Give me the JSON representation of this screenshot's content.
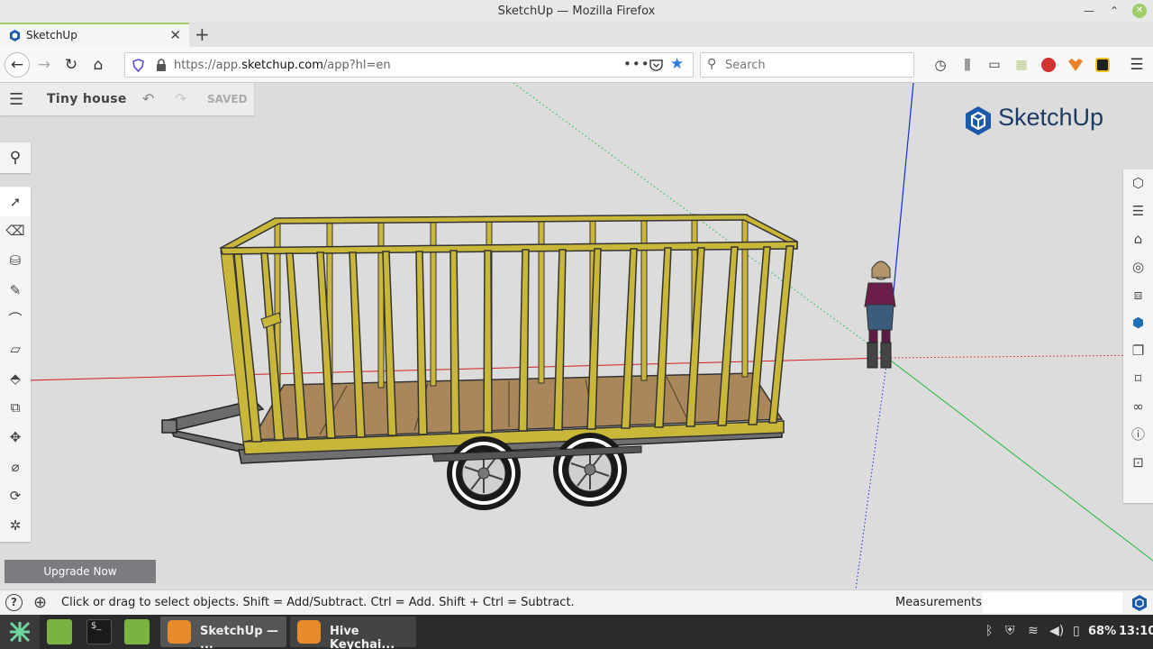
{
  "window": {
    "title": "SketchUp — Mozilla Firefox"
  },
  "browser": {
    "tab_label": "SketchUp",
    "url_prefix": "https://app.",
    "url_domain": "sketchup.com",
    "url_path": "/app?hl=en",
    "search_placeholder": "Search"
  },
  "app": {
    "doc_title": "Tiny house",
    "save_state": "SAVED",
    "upgrade_label": "Upgrade Now",
    "brand": "SketchUp"
  },
  "left_tools": [
    {
      "name": "select",
      "icon": "arrow-pointer-icon"
    },
    {
      "name": "eraser",
      "icon": "eraser-icon"
    },
    {
      "name": "paint",
      "icon": "paint-bucket-icon"
    },
    {
      "name": "line",
      "icon": "pencil-icon"
    },
    {
      "name": "arc",
      "icon": "arc-icon"
    },
    {
      "name": "rectangle",
      "icon": "rectangle-icon"
    },
    {
      "name": "push-pull",
      "icon": "push-pull-icon"
    },
    {
      "name": "offset",
      "icon": "offset-icon"
    },
    {
      "name": "move",
      "icon": "move-icon"
    },
    {
      "name": "tape",
      "icon": "tape-measure-icon"
    },
    {
      "name": "orbit",
      "icon": "orbit-icon"
    },
    {
      "name": "walk",
      "icon": "walk-icon"
    }
  ],
  "right_tools": [
    "entity-info-icon",
    "outliner-icon",
    "instructor-icon",
    "materials-icon",
    "components-icon",
    "styles-icon",
    "layers-icon",
    "scenes-icon",
    "display-icon",
    "model-info-icon",
    "extension-icon"
  ],
  "status": {
    "hint": "Click or drag to select objects. Shift = Add/Subtract. Ctrl = Add. Shift + Ctrl = Subtract.",
    "measurements_label": "Measurements",
    "measurements_value": ""
  },
  "taskbar": {
    "tasks": [
      {
        "label": "SketchUp — ..."
      },
      {
        "label": "Hive Keychai..."
      }
    ],
    "battery": "68%",
    "clock": "13:10"
  },
  "colors": {
    "framing": "#c9b73a",
    "floor": "#a9875a",
    "axis_red": "#d22020",
    "axis_green": "#1fb83a",
    "axis_blue": "#1a2ed8",
    "accent": "#9fce69",
    "brand": "#1c3b63"
  }
}
